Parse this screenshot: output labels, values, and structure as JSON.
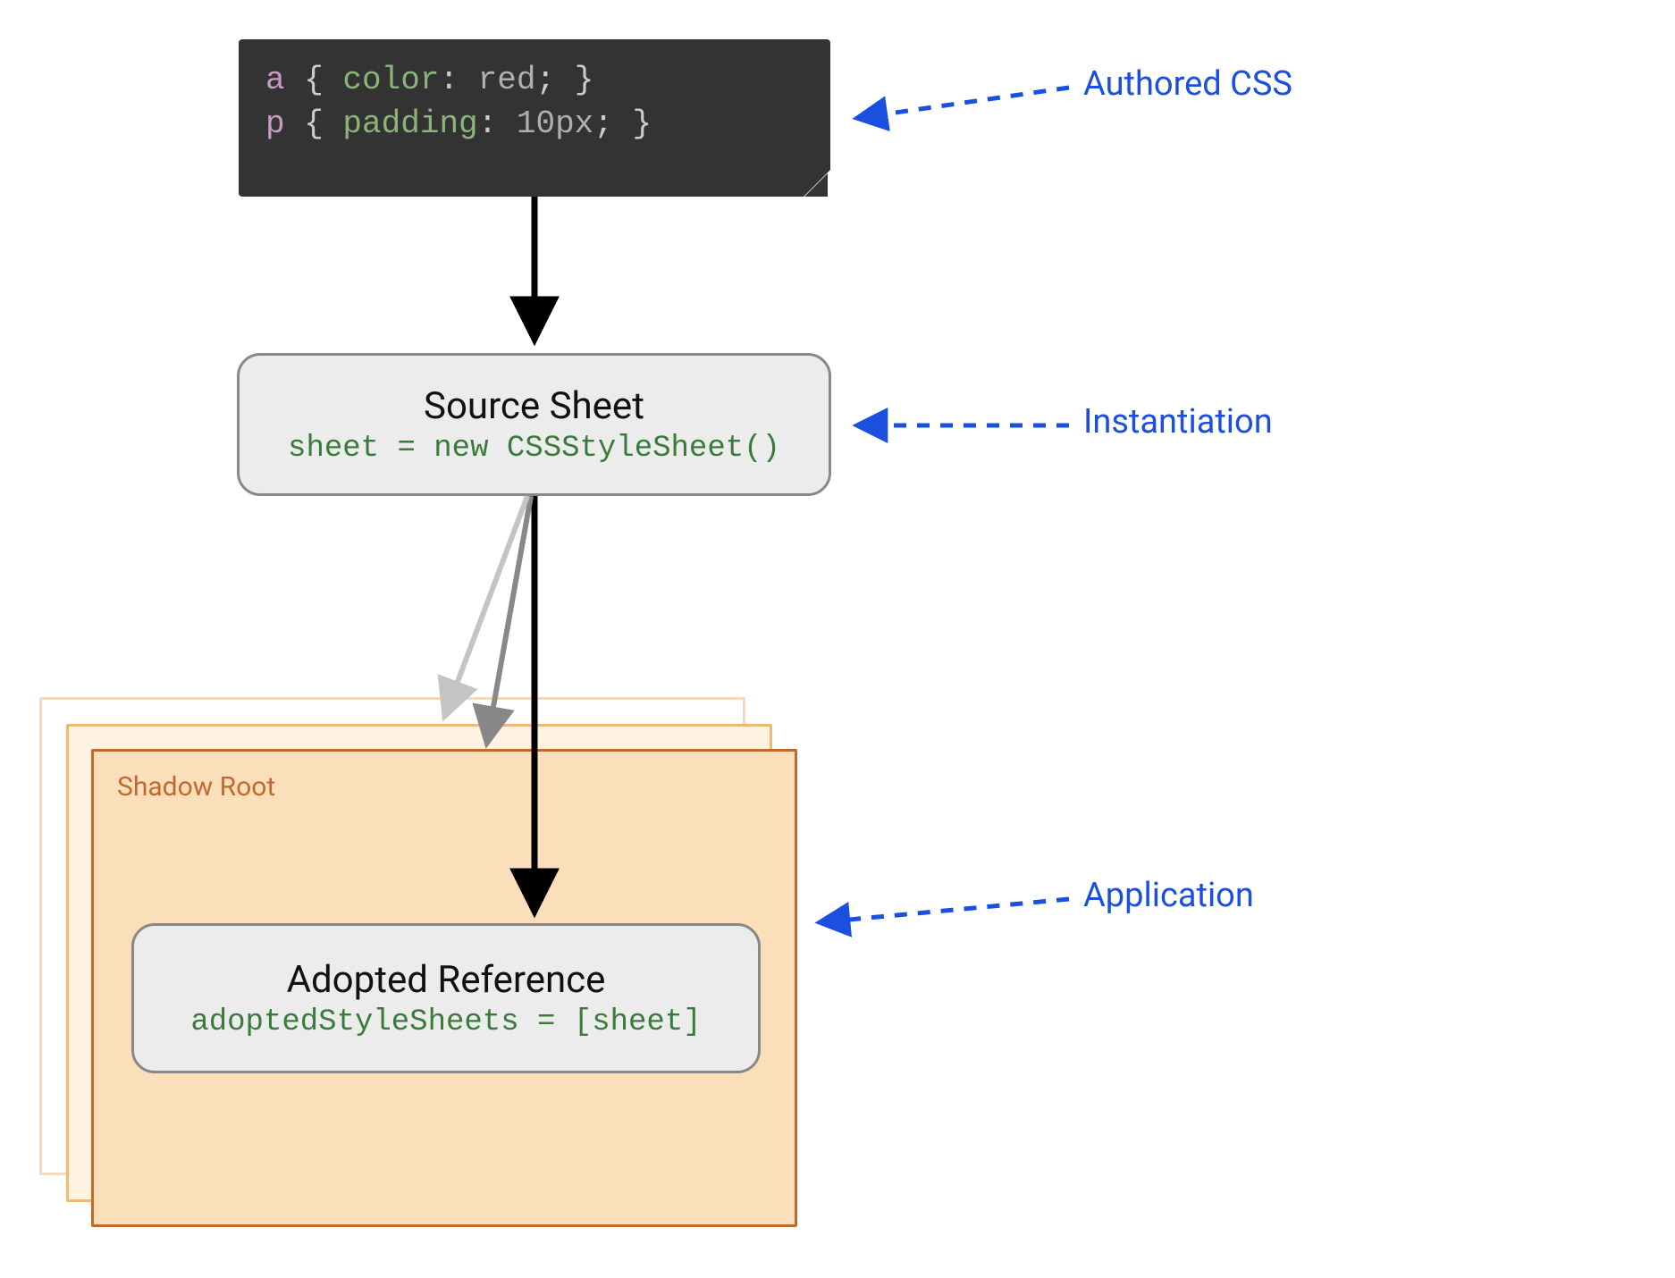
{
  "code": {
    "line1": {
      "sel": "a",
      "open": " { ",
      "prop": "color",
      "colon": ": ",
      "val": "red",
      "close": "; }"
    },
    "line2": {
      "sel": "p",
      "open": " { ",
      "prop": "padding",
      "colon": ": ",
      "val": "10px",
      "close": "; }"
    }
  },
  "source_sheet": {
    "title": "Source Sheet",
    "code": "sheet = new CSSStyleSheet()"
  },
  "shadow_root": {
    "label": "Shadow Root",
    "adopted": {
      "title": "Adopted Reference",
      "code": "adoptedStyleSheets = [sheet]"
    }
  },
  "annotations": {
    "authored_css": "Authored CSS",
    "instantiation": "Instantiation",
    "application": "Application"
  }
}
